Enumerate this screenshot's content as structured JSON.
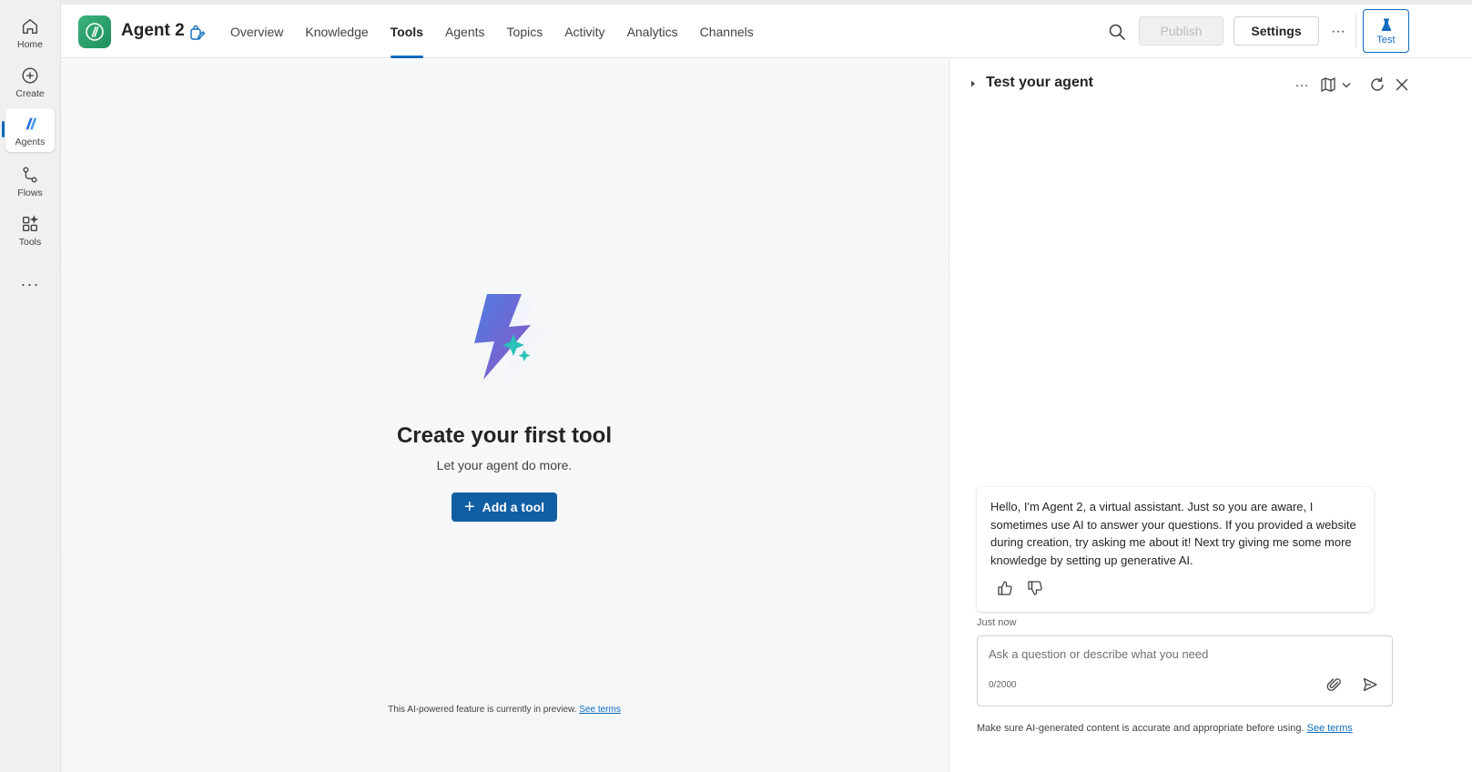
{
  "rail": {
    "items": [
      {
        "label": "Home",
        "icon": "home-icon"
      },
      {
        "label": "Create",
        "icon": "plus-circle-icon"
      },
      {
        "label": "Agents",
        "icon": "agents-icon"
      },
      {
        "label": "Flows",
        "icon": "flows-icon"
      },
      {
        "label": "Tools",
        "icon": "tools-icon"
      }
    ],
    "more": "···"
  },
  "header": {
    "agent_name": "Agent 2",
    "tabs": [
      "Overview",
      "Knowledge",
      "Tools",
      "Agents",
      "Topics",
      "Activity",
      "Analytics",
      "Channels"
    ],
    "active_tab": "Tools",
    "publish_label": "Publish",
    "settings_label": "Settings",
    "more_label": "···",
    "test_label": "Test"
  },
  "main": {
    "title": "Create your first tool",
    "subtitle": "Let your agent do more.",
    "add_button": "Add a tool",
    "preview_note": "This AI-powered feature is currently in preview.",
    "preview_link": "See terms"
  },
  "test_panel": {
    "title": "Test your agent",
    "more_label": "···",
    "message": "Hello, I'm Agent 2, a virtual assistant. Just so you are aware, I sometimes use AI to answer your questions. If you provided a website during creation, try asking me about it! Next try giving me some more knowledge by setting up generative AI.",
    "timestamp": "Just now",
    "input_placeholder": "Ask a question or describe what you need",
    "counter": "0/2000",
    "disclaimer": "Make sure AI-generated content is accurate and appropriate before using.",
    "disclaimer_link": "See terms"
  },
  "colors": {
    "accent": "#0f6cbd",
    "primary_button": "#115ea3",
    "agent_logo": "#2a9d6a"
  }
}
